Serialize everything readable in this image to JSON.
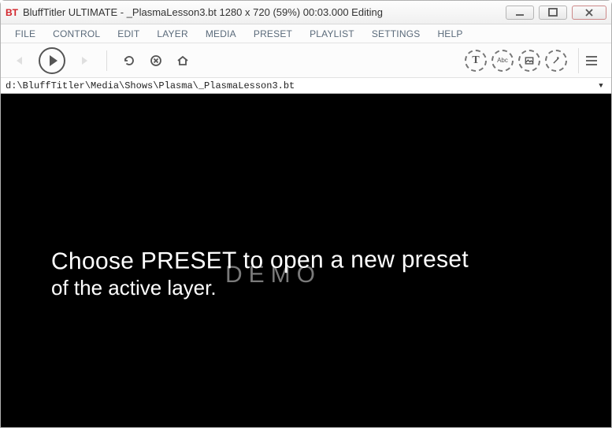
{
  "window": {
    "title": "BluffTitler ULTIMATE  -  _PlasmaLesson3.bt 1280 x 720 (59%) 00:03.000 Editing",
    "app_icon_text": "BT"
  },
  "menu": {
    "items": [
      "FILE",
      "CONTROL",
      "EDIT",
      "LAYER",
      "MEDIA",
      "PRESET",
      "PLAYLIST",
      "SETTINGS",
      "HELP"
    ]
  },
  "toolbar": {
    "add_text_label": "T",
    "add_abc_label": "Abc"
  },
  "pathbar": {
    "path": "d:\\BluffTitler\\Media\\Shows\\Plasma\\_PlasmaLesson3.bt"
  },
  "viewport": {
    "line1": "Choose PRESET to open a new preset",
    "line2": "of the active layer.",
    "watermark": "DEMO"
  }
}
